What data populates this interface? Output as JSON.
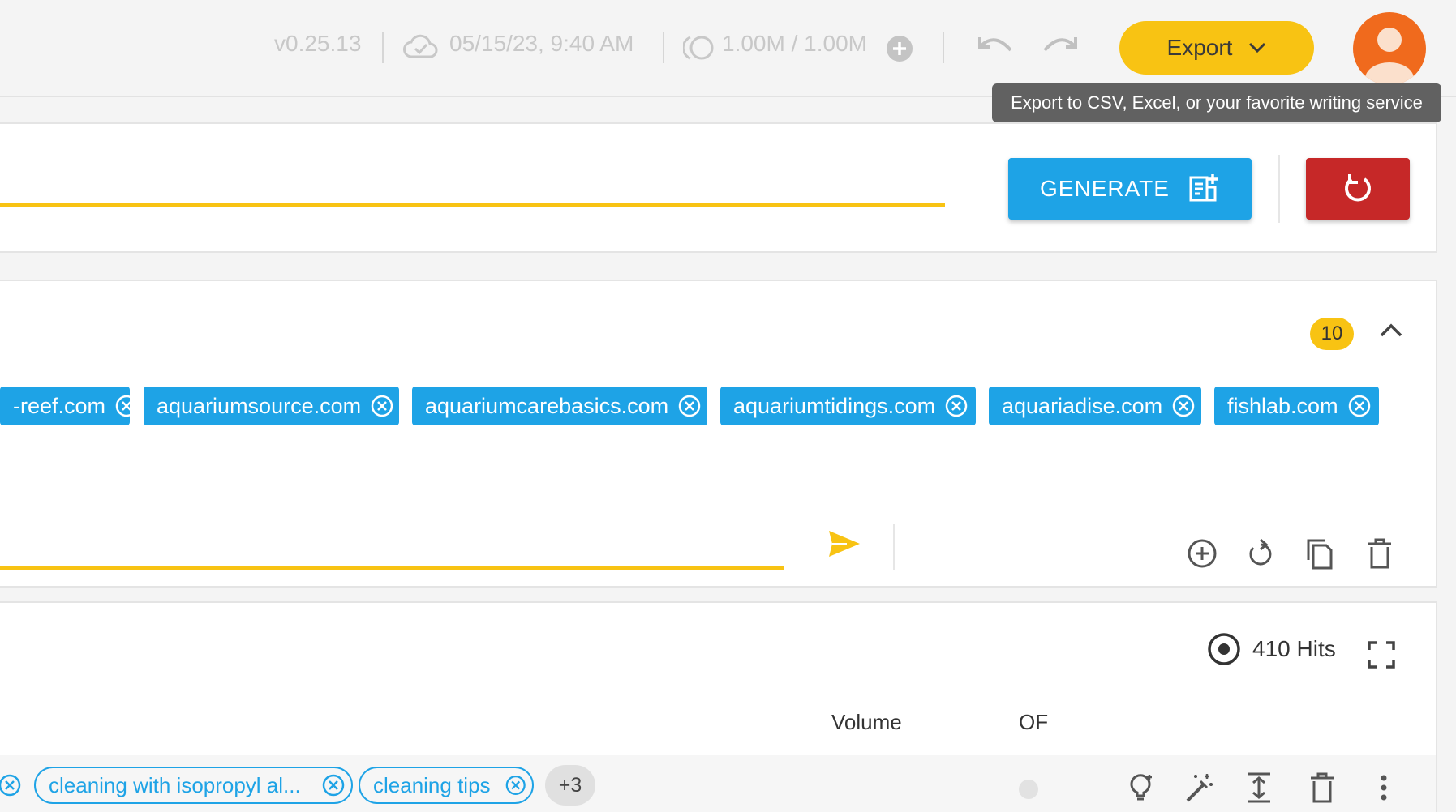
{
  "header": {
    "version": "v0.25.13",
    "saved_time": "05/15/23, 9:40 AM",
    "credits": "1.00M / 1.00M",
    "export_label": "Export",
    "export_tooltip": "Export to CSV, Excel, or your favorite writing service"
  },
  "generate_panel": {
    "generate_label": "GENERATE"
  },
  "domains_panel": {
    "count": "10",
    "chips": [
      "-reef.com",
      "aquariumsource.com",
      "aquariumcarebasics.com",
      "aquariumtidings.com",
      "aquariadise.com",
      "fishlab.com"
    ]
  },
  "results_panel": {
    "hits": "410 Hits",
    "columns": {
      "volume": "Volume",
      "of": "OF"
    },
    "row": {
      "tags": [
        "cleaning with isopropyl al...",
        "cleaning tips"
      ],
      "more": "+3"
    }
  },
  "colors": {
    "accent_yellow": "#f8c313",
    "chip_blue": "#1ea3e6",
    "danger_red": "#c62828",
    "avatar_orange": "#f06a1d"
  },
  "icons": [
    "cloud-icon",
    "credits-icon",
    "plus-circle-icon",
    "undo-icon",
    "redo-icon",
    "chevron-down-icon",
    "user-icon",
    "note-add-icon",
    "reset-icon",
    "chevron-up-icon",
    "close-circle-icon",
    "send-icon",
    "add-circle-icon",
    "refresh-icon",
    "copy-icon",
    "delete-icon",
    "target-icon",
    "fullscreen-icon",
    "lightbulb-icon",
    "magic-wand-icon",
    "expand-vertical-icon",
    "more-vert-icon"
  ]
}
